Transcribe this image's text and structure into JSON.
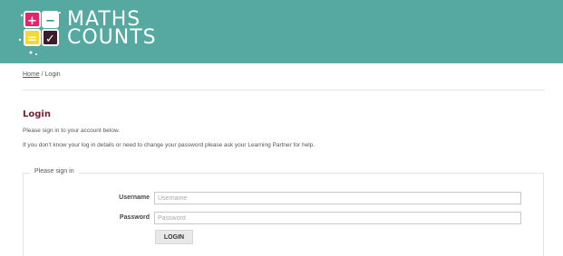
{
  "header": {
    "logo": {
      "line1": "MATHS",
      "line2": "COUNTS",
      "tile_plus": "+",
      "tile_minus": "−",
      "tile_equals": "=",
      "tile_check": "✓",
      "brand_color": "#55a9a0"
    }
  },
  "breadcrumb": {
    "home": "Home",
    "separator": " / ",
    "current": "Login"
  },
  "page": {
    "title": "Login",
    "intro_line1": "Please sign in to your account below.",
    "intro_line2": "If you don't know your log in details or need to change your password please ask your Learning Partner for help."
  },
  "form": {
    "legend": "Please sign in",
    "username_label": "Username",
    "username_placeholder": "Username",
    "username_value": "",
    "password_label": "Password",
    "password_placeholder": "Password",
    "password_value": "",
    "submit_label": "LOGIN"
  },
  "colors": {
    "title": "#7a1e2f",
    "header_bg": "#55a9a0"
  }
}
